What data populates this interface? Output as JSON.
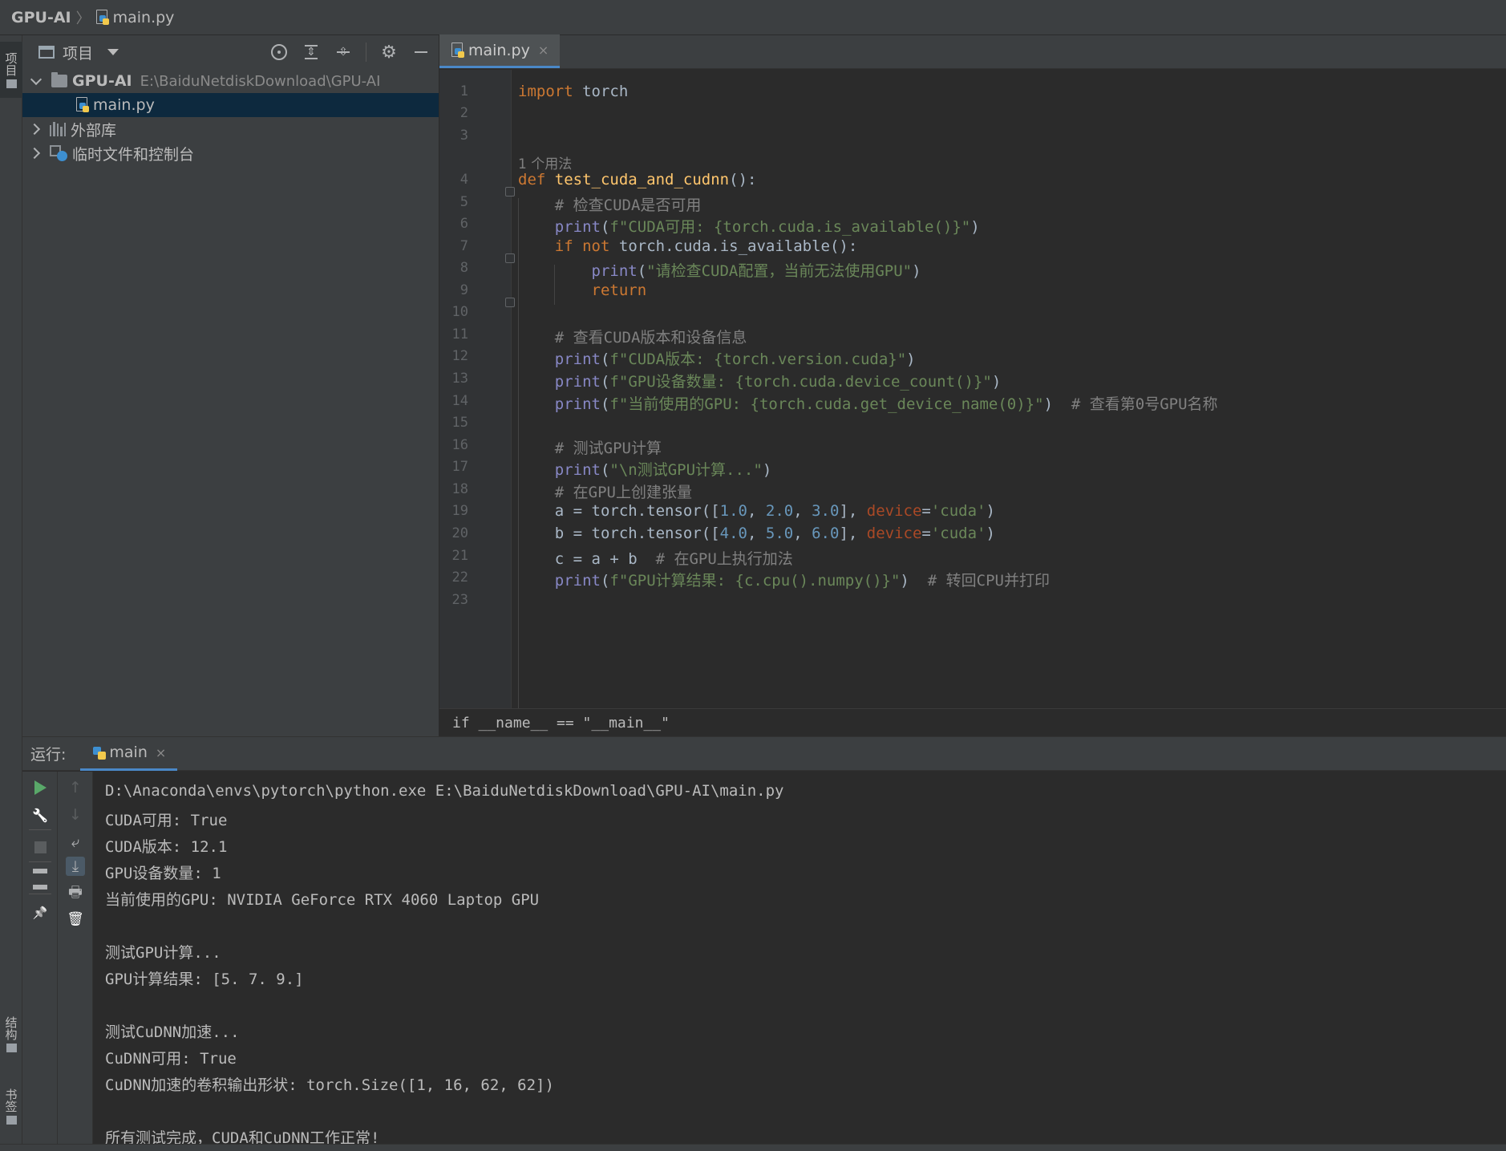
{
  "navbar": {
    "project": "GPU-AI",
    "file": "main.py"
  },
  "left_stripe": {
    "project": "项目",
    "structure": "结构",
    "bookmarks": "书签"
  },
  "project_panel": {
    "title": "项目",
    "tree": [
      {
        "label": "GPU-AI",
        "hint": "E:\\BaiduNetdiskDownload\\GPU-AI"
      },
      {
        "label": "main.py"
      },
      {
        "label": "外部库"
      },
      {
        "label": "临时文件和控制台"
      }
    ]
  },
  "editor": {
    "tab": {
      "label": "main.py",
      "close": "×"
    },
    "usage_hint": "1 个用法",
    "footer_breadcrumb": "if __name__ == \"__main__\""
  },
  "code_lines": [
    {
      "n": "1",
      "t": "import torch"
    },
    {
      "n": "2",
      "t": ""
    },
    {
      "n": "3",
      "t": ""
    },
    {
      "n": "4",
      "t": "def test_cuda_and_cudnn():"
    },
    {
      "n": "5",
      "t": "    # 检查CUDA是否可用"
    },
    {
      "n": "6",
      "t": "    print(f\"CUDA可用: {torch.cuda.is_available()}\")"
    },
    {
      "n": "7",
      "t": "    if not torch.cuda.is_available():"
    },
    {
      "n": "8",
      "t": "        print(\"请检查CUDA配置，当前无法使用GPU\")"
    },
    {
      "n": "9",
      "t": "        return"
    },
    {
      "n": "10",
      "t": ""
    },
    {
      "n": "11",
      "t": "    # 查看CUDA版本和设备信息"
    },
    {
      "n": "12",
      "t": "    print(f\"CUDA版本: {torch.version.cuda}\")"
    },
    {
      "n": "13",
      "t": "    print(f\"GPU设备数量: {torch.cuda.device_count()}\")"
    },
    {
      "n": "14",
      "t": "    print(f\"当前使用的GPU: {torch.cuda.get_device_name(0)}\")  # 查看第0号GPU名称"
    },
    {
      "n": "15",
      "t": ""
    },
    {
      "n": "16",
      "t": "    # 测试GPU计算"
    },
    {
      "n": "17",
      "t": "    print(\"\\n测试GPU计算...\")"
    },
    {
      "n": "18",
      "t": "    # 在GPU上创建张量"
    },
    {
      "n": "19",
      "t": "    a = torch.tensor([1.0, 2.0, 3.0], device='cuda')"
    },
    {
      "n": "20",
      "t": "    b = torch.tensor([4.0, 5.0, 6.0], device='cuda')"
    },
    {
      "n": "21",
      "t": "    c = a + b  # 在GPU上执行加法"
    },
    {
      "n": "22",
      "t": "    print(f\"GPU计算结果: {c.cpu().numpy()}\")  # 转回CPU并打印"
    },
    {
      "n": "23",
      "t": ""
    }
  ],
  "run": {
    "label": "运行:",
    "tab": "main",
    "close": "×",
    "output": [
      "D:\\Anaconda\\envs\\pytorch\\python.exe E:\\BaiduNetdiskDownload\\GPU-AI\\main.py",
      "CUDA可用: True",
      "CUDA版本: 12.1",
      "GPU设备数量: 1",
      "当前使用的GPU: NVIDIA GeForce RTX 4060 Laptop GPU",
      "",
      "测试GPU计算...",
      "GPU计算结果: [5. 7. 9.]",
      "",
      "测试CuDNN加速...",
      "CuDNN可用: True",
      "CuDNN加速的卷积输出形状: torch.Size([1, 16, 62, 62])",
      "",
      "所有测试完成，CUDA和CuDNN工作正常!"
    ]
  }
}
